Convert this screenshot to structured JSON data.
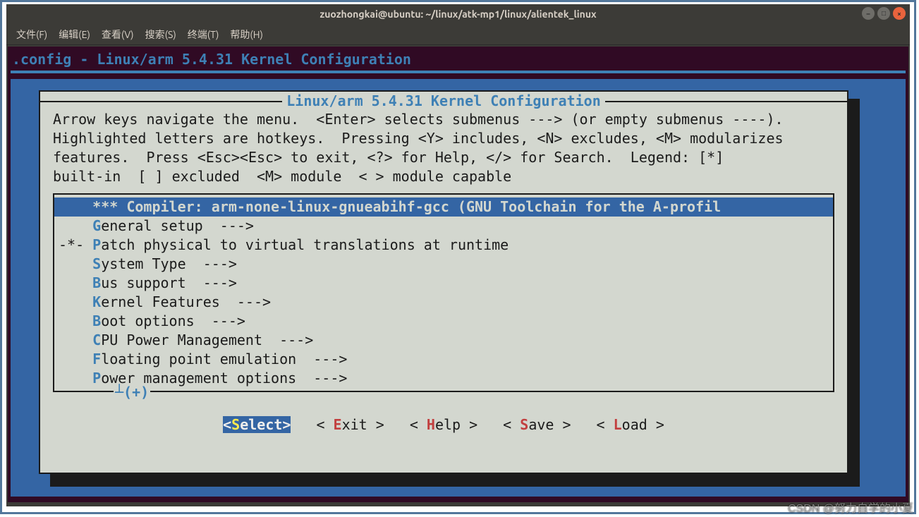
{
  "window": {
    "title": "zuozhongkai@ubuntu: ~/linux/atk-mp1/linux/alientek_linux"
  },
  "menubar": {
    "items": [
      "文件(F)",
      "编辑(E)",
      "查看(V)",
      "搜索(S)",
      "终端(T)",
      "帮助(H)"
    ]
  },
  "config": {
    "header": ".config - Linux/arm 5.4.31 Kernel Configuration",
    "box_title": "Linux/arm 5.4.31 Kernel Configuration",
    "instructions_l1": "Arrow keys navigate the menu.  <Enter> selects submenus ---> (or empty submenus ----).",
    "instructions_l2": "Highlighted letters are hotkeys.  Pressing <Y> includes, <N> excludes, <M> modularizes",
    "instructions_l3": "features.  Press <Esc><Esc> to exit, <?> for Help, </> for Search.  Legend: [*]",
    "instructions_l4": "built-in  [ ] excluded  <M> module  < > module capable"
  },
  "menu_items": {
    "compiler": "    *** Compiler: arm-none-linux-gnueabihf-gcc (GNU Toolchain for the A-profil",
    "general_pre": "    ",
    "general_hot": "G",
    "general_rest": "eneral setup  --->",
    "patch_pre": "-*- ",
    "patch_hot": "P",
    "patch_rest": "atch physical to virtual translations at runtime",
    "system_pre": "    ",
    "system_hot": "S",
    "system_rest": "ystem Type  --->",
    "bus_pre": "    ",
    "bus_hot": "B",
    "bus_rest": "us support  --->",
    "kernel_pre": "    ",
    "kernel_hot": "K",
    "kernel_rest": "ernel Features  --->",
    "boot_pre": "    ",
    "boot_hot": "B",
    "boot_rest": "oot options  --->",
    "cpu_pre": "    ",
    "cpu_hot": "C",
    "cpu_rest": "PU Power Management  --->",
    "float_pre": "    ",
    "float_hot": "F",
    "float_rest": "loating point emulation  --->",
    "power_pre": "    ",
    "power_hot": "P",
    "power_rest": "ower management options  --->"
  },
  "scroll_indicator": "┴(+)",
  "buttons": {
    "select_open": "<",
    "select_hot": "S",
    "select_rest": "elect>",
    "exit_open": "< ",
    "exit_hot": "E",
    "exit_rest": "xit >",
    "help_open": "< ",
    "help_hot": "H",
    "help_rest": "elp >",
    "save_open": "< ",
    "save_hot": "S",
    "save_rest": "ave >",
    "load_open": "< ",
    "load_hot": "L",
    "load_rest": "oad >"
  },
  "watermark": "CSDN @努力自学的小夏"
}
